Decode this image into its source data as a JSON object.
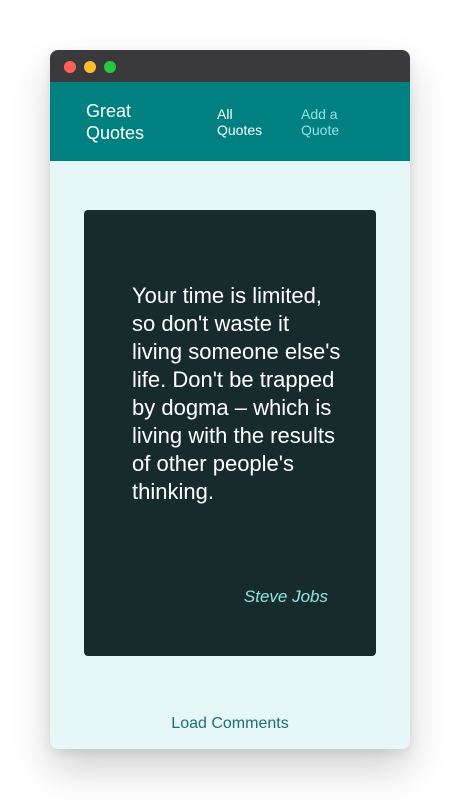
{
  "window": {
    "controls": [
      "close",
      "minimize",
      "maximize"
    ]
  },
  "header": {
    "brand": "Great Quotes",
    "nav": [
      {
        "label": "All Quotes",
        "active": true
      },
      {
        "label": "Add a Quote",
        "active": false
      }
    ]
  },
  "quote": {
    "text": "Your time is limited, so don't waste it living someone else's life. Don't be trapped by dogma – which is living with the results of other people's thinking.",
    "author": "Steve Jobs"
  },
  "footer": {
    "load_comments_label": "Load Comments"
  },
  "colors": {
    "header_bg": "#008080",
    "page_bg": "#e6f7f7",
    "card_bg": "#172b2d",
    "accent": "#8fe3e3"
  }
}
